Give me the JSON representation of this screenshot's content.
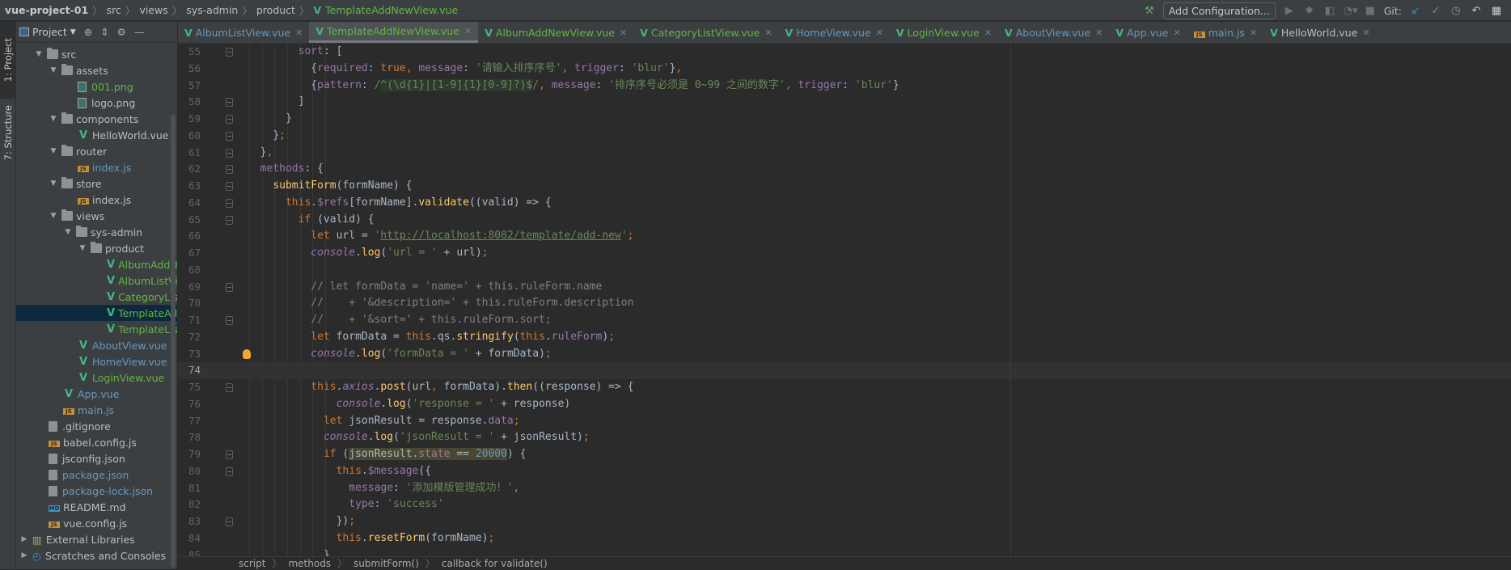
{
  "navbar": {
    "breadcrumb": [
      "vue-project-01",
      "src",
      "views",
      "sys-admin",
      "product"
    ],
    "current_file": "TemplateAddNewView.vue",
    "add_configuration": "Add Configuration...",
    "git_label": "Git:"
  },
  "side_stripe": {
    "project_tab": "1: Project",
    "structure_tab": "7: Structure"
  },
  "project_panel": {
    "title": "Project",
    "tree": [
      {
        "label": "src",
        "depth": 0,
        "kind": "folder",
        "expanded": true,
        "color": "def"
      },
      {
        "label": "assets",
        "depth": 1,
        "kind": "folder",
        "expanded": true,
        "color": "def"
      },
      {
        "label": "001.png",
        "depth": 2,
        "kind": "image",
        "color": "green"
      },
      {
        "label": "logo.png",
        "depth": 2,
        "kind": "image",
        "color": "def"
      },
      {
        "label": "components",
        "depth": 1,
        "kind": "folder",
        "expanded": true,
        "color": "def"
      },
      {
        "label": "HelloWorld.vue",
        "depth": 2,
        "kind": "vue",
        "color": "def"
      },
      {
        "label": "router",
        "depth": 1,
        "kind": "folder",
        "expanded": true,
        "color": "def"
      },
      {
        "label": "index.js",
        "depth": 2,
        "kind": "js",
        "color": "blue"
      },
      {
        "label": "store",
        "depth": 1,
        "kind": "folder",
        "expanded": true,
        "color": "def"
      },
      {
        "label": "index.js",
        "depth": 2,
        "kind": "js",
        "color": "def"
      },
      {
        "label": "views",
        "depth": 1,
        "kind": "folder",
        "expanded": true,
        "color": "def"
      },
      {
        "label": "sys-admin",
        "depth": 2,
        "kind": "folder",
        "expanded": true,
        "color": "def"
      },
      {
        "label": "product",
        "depth": 3,
        "kind": "folder",
        "expanded": true,
        "color": "def"
      },
      {
        "label": "AlbumAddNewView.vue",
        "depth": 4,
        "kind": "vue",
        "color": "green"
      },
      {
        "label": "AlbumListView.vue",
        "depth": 4,
        "kind": "vue",
        "color": "green"
      },
      {
        "label": "CategoryListView.vue",
        "depth": 4,
        "kind": "vue",
        "color": "green"
      },
      {
        "label": "TemplateAddNewView.vue",
        "depth": 4,
        "kind": "vue",
        "color": "green",
        "selected": true
      },
      {
        "label": "TemplateListView.vue",
        "depth": 4,
        "kind": "vue",
        "color": "green"
      },
      {
        "label": "AboutView.vue",
        "depth": 2,
        "kind": "vue",
        "color": "blue"
      },
      {
        "label": "HomeView.vue",
        "depth": 2,
        "kind": "vue",
        "color": "blue"
      },
      {
        "label": "LoginView.vue",
        "depth": 2,
        "kind": "vue",
        "color": "green"
      },
      {
        "label": "App.vue",
        "depth": 1,
        "kind": "vue",
        "color": "blue"
      },
      {
        "label": "main.js",
        "depth": 1,
        "kind": "js",
        "color": "blue"
      },
      {
        "label": ".gitignore",
        "depth": 0,
        "kind": "file",
        "color": "def"
      },
      {
        "label": "babel.config.js",
        "depth": 0,
        "kind": "js",
        "color": "def"
      },
      {
        "label": "jsconfig.json",
        "depth": 0,
        "kind": "file",
        "color": "def"
      },
      {
        "label": "package.json",
        "depth": 0,
        "kind": "file",
        "color": "blue"
      },
      {
        "label": "package-lock.json",
        "depth": 0,
        "kind": "file",
        "color": "blue"
      },
      {
        "label": "README.md",
        "depth": 0,
        "kind": "md",
        "color": "def"
      },
      {
        "label": "vue.config.js",
        "depth": 0,
        "kind": "js",
        "color": "def"
      },
      {
        "label": "External Libraries",
        "depth": -1,
        "kind": "lib",
        "expanded": false,
        "color": "def"
      },
      {
        "label": "Scratches and Consoles",
        "depth": -1,
        "kind": "scratch",
        "expanded": false,
        "color": "def"
      }
    ]
  },
  "tabs": [
    {
      "label": "AlbumListView.vue",
      "kind": "vue",
      "color": "blue"
    },
    {
      "label": "TemplateAddNewView.vue",
      "kind": "vue",
      "color": "green",
      "active": true
    },
    {
      "label": "AlbumAddNewView.vue",
      "kind": "vue",
      "color": "green"
    },
    {
      "label": "CategoryListView.vue",
      "kind": "vue",
      "color": "green"
    },
    {
      "label": "HomeView.vue",
      "kind": "vue",
      "color": "blue"
    },
    {
      "label": "LoginView.vue",
      "kind": "vue",
      "color": "green"
    },
    {
      "label": "AboutView.vue",
      "kind": "vue",
      "color": "blue"
    },
    {
      "label": "App.vue",
      "kind": "vue",
      "color": "blue"
    },
    {
      "label": "main.js",
      "kind": "js",
      "color": "blue"
    },
    {
      "label": "HelloWorld.vue",
      "kind": "vue",
      "color": "def"
    }
  ],
  "editor": {
    "current_line": 74,
    "lines": [
      {
        "n": "55",
        "indent": 8,
        "fold": true,
        "tokens": [
          [
            "f",
            "sort"
          ],
          [
            "p",
            ": ["
          ]
        ]
      },
      {
        "n": "56",
        "indent": 10,
        "tokens": [
          [
            "p",
            "{"
          ],
          [
            "f",
            "required"
          ],
          [
            "p",
            ": "
          ],
          [
            "k",
            "true,"
          ],
          [
            "p",
            " "
          ],
          [
            "f",
            "message"
          ],
          [
            "p",
            ": "
          ],
          [
            "s",
            "'请输入排序序号'"
          ],
          [
            "k",
            ","
          ],
          [
            "p",
            " "
          ],
          [
            "f",
            "trigger"
          ],
          [
            "p",
            ": "
          ],
          [
            "s",
            "'blur'"
          ],
          [
            "p",
            "}"
          ],
          [
            "k",
            ","
          ]
        ]
      },
      {
        "n": "57",
        "indent": 10,
        "tokens": [
          [
            "p",
            "{"
          ],
          [
            "f",
            "pattern"
          ],
          [
            "p",
            ": "
          ],
          [
            "s",
            "/"
          ],
          [
            "r",
            "^(\\d{1}|[1-9]{1}[0-9]?)$"
          ],
          [
            "s",
            "/"
          ],
          [
            "k",
            ","
          ],
          [
            "p",
            " "
          ],
          [
            "f",
            "message"
          ],
          [
            "p",
            ": "
          ],
          [
            "s",
            "'排序序号必须是 0~99 之间的数字'"
          ],
          [
            "k",
            ","
          ],
          [
            "p",
            " "
          ],
          [
            "f",
            "trigger"
          ],
          [
            "p",
            ": "
          ],
          [
            "s",
            "'blur'"
          ],
          [
            "p",
            "}"
          ]
        ]
      },
      {
        "n": "58",
        "indent": 8,
        "fold": true,
        "tokens": [
          [
            "p",
            "]"
          ]
        ]
      },
      {
        "n": "59",
        "indent": 6,
        "fold": true,
        "tokens": [
          [
            "p",
            "}"
          ]
        ]
      },
      {
        "n": "60",
        "indent": 4,
        "fold": true,
        "tokens": [
          [
            "p",
            "}"
          ],
          [
            "k",
            ";"
          ]
        ]
      },
      {
        "n": "61",
        "indent": 2,
        "fold": true,
        "tokens": [
          [
            "p",
            "}"
          ],
          [
            "k",
            ","
          ]
        ]
      },
      {
        "n": "62",
        "indent": 2,
        "fold": true,
        "tokens": [
          [
            "f",
            "methods"
          ],
          [
            "p",
            ": {"
          ]
        ]
      },
      {
        "n": "63",
        "indent": 4,
        "fold": true,
        "tokens": [
          [
            "fn",
            "submitForm"
          ],
          [
            "p",
            "(formName) {"
          ]
        ]
      },
      {
        "n": "64",
        "indent": 6,
        "fold": true,
        "tokens": [
          [
            "k",
            "this"
          ],
          [
            "p",
            "."
          ],
          [
            "f",
            "$refs"
          ],
          [
            "p",
            "[formName]."
          ],
          [
            "fn",
            "validate"
          ],
          [
            "p",
            "((valid) => {"
          ]
        ]
      },
      {
        "n": "65",
        "indent": 8,
        "fold": true,
        "tokens": [
          [
            "k",
            "if"
          ],
          [
            "p",
            " (valid) {"
          ]
        ]
      },
      {
        "n": "66",
        "indent": 10,
        "tokens": [
          [
            "k",
            "let"
          ],
          [
            "p",
            " url = "
          ],
          [
            "s",
            "'"
          ],
          [
            "u",
            "http://localhost:8082/template/add-new"
          ],
          [
            "s",
            "'"
          ],
          [
            "k",
            ";"
          ]
        ]
      },
      {
        "n": "67",
        "indent": 10,
        "tokens": [
          [
            "i",
            "console"
          ],
          [
            "p",
            "."
          ],
          [
            "fn",
            "log"
          ],
          [
            "p",
            "("
          ],
          [
            "s",
            "'url = '"
          ],
          [
            "p",
            " + url)"
          ],
          [
            "k",
            ";"
          ]
        ]
      },
      {
        "n": "68",
        "indent": 10,
        "tokens": []
      },
      {
        "n": "69",
        "indent": 10,
        "fold": true,
        "tokens": [
          [
            "c",
            "// let formData = 'name=' + this.ruleForm.name"
          ]
        ]
      },
      {
        "n": "70",
        "indent": 10,
        "tokens": [
          [
            "c",
            "//    + '&description=' + this.ruleForm.description"
          ]
        ]
      },
      {
        "n": "71",
        "indent": 10,
        "fold": true,
        "tokens": [
          [
            "c",
            "//    + '&sort=' + this.ruleForm.sort;"
          ]
        ]
      },
      {
        "n": "72",
        "indent": 10,
        "tokens": [
          [
            "k",
            "let"
          ],
          [
            "p",
            " formData = "
          ],
          [
            "k",
            "this"
          ],
          [
            "p",
            ".qs."
          ],
          [
            "fn",
            "stringify"
          ],
          [
            "p",
            "("
          ],
          [
            "k",
            "this"
          ],
          [
            "p",
            "."
          ],
          [
            "f",
            "ruleForm"
          ],
          [
            "p",
            ")"
          ],
          [
            "k",
            ";"
          ]
        ]
      },
      {
        "n": "73",
        "indent": 10,
        "bulb": true,
        "tokens": [
          [
            "i",
            "console"
          ],
          [
            "p",
            "."
          ],
          [
            "fn",
            "log"
          ],
          [
            "p",
            "("
          ],
          [
            "s",
            "'formData = '"
          ],
          [
            "p",
            " + formData)"
          ],
          [
            "k",
            ";"
          ]
        ]
      },
      {
        "n": "74",
        "indent": 10,
        "tokens": []
      },
      {
        "n": "75",
        "indent": 10,
        "fold": true,
        "tokens": [
          [
            "k",
            "this"
          ],
          [
            "p",
            "."
          ],
          [
            "i",
            "axios"
          ],
          [
            "p",
            "."
          ],
          [
            "fn",
            "post"
          ],
          [
            "p",
            "(url"
          ],
          [
            "k",
            ","
          ],
          [
            "p",
            " formData)."
          ],
          [
            "fn",
            "then"
          ],
          [
            "p",
            "((response) => {"
          ]
        ]
      },
      {
        "n": "76",
        "indent": 14,
        "tokens": [
          [
            "i",
            "console"
          ],
          [
            "p",
            "."
          ],
          [
            "fn",
            "log"
          ],
          [
            "p",
            "("
          ],
          [
            "s",
            "'response = '"
          ],
          [
            "p",
            " + response)"
          ]
        ]
      },
      {
        "n": "77",
        "indent": 12,
        "tokens": [
          [
            "k",
            "let"
          ],
          [
            "p",
            " jsonResult = response."
          ],
          [
            "f",
            "data"
          ],
          [
            "k",
            ";"
          ]
        ]
      },
      {
        "n": "78",
        "indent": 12,
        "tokens": [
          [
            "i",
            "console"
          ],
          [
            "p",
            "."
          ],
          [
            "fn",
            "log"
          ],
          [
            "p",
            "("
          ],
          [
            "s",
            "'jsonResult = '"
          ],
          [
            "p",
            " + jsonResult)"
          ],
          [
            "k",
            ";"
          ]
        ]
      },
      {
        "n": "79",
        "indent": 12,
        "fold": true,
        "tokens": [
          [
            "k",
            "if"
          ],
          [
            "p",
            " ("
          ],
          [
            "p",
            "jsonResult.",
            "hl"
          ],
          [
            "f",
            "state",
            "hl"
          ],
          [
            "p",
            " == ",
            "hl"
          ],
          [
            "n",
            "20000",
            "hl"
          ],
          [
            "p",
            ") {"
          ]
        ]
      },
      {
        "n": "80",
        "indent": 14,
        "fold": true,
        "tokens": [
          [
            "k",
            "this"
          ],
          [
            "p",
            "."
          ],
          [
            "f",
            "$message"
          ],
          [
            "p",
            "({"
          ]
        ]
      },
      {
        "n": "81",
        "indent": 16,
        "tokens": [
          [
            "f",
            "message"
          ],
          [
            "p",
            ": "
          ],
          [
            "s",
            "'添加模版管理成功！'"
          ],
          [
            "k",
            ","
          ]
        ]
      },
      {
        "n": "82",
        "indent": 16,
        "tokens": [
          [
            "f",
            "type"
          ],
          [
            "p",
            ": "
          ],
          [
            "s",
            "'success'"
          ]
        ]
      },
      {
        "n": "83",
        "indent": 14,
        "fold": true,
        "tokens": [
          [
            "p",
            "})"
          ],
          [
            "k",
            ";"
          ]
        ]
      },
      {
        "n": "84",
        "indent": 14,
        "tokens": [
          [
            "k",
            "this"
          ],
          [
            "p",
            "."
          ],
          [
            "fn",
            "resetForm"
          ],
          [
            "p",
            "(formName)"
          ],
          [
            "k",
            ";"
          ]
        ]
      },
      {
        "n": "85",
        "indent": 12,
        "tokens": [
          [
            "p",
            "}"
          ]
        ]
      }
    ]
  },
  "editor_breadcrumb": [
    "script",
    "methods",
    "submitForm()",
    "callback for validate()"
  ],
  "browser_icons": [
    {
      "name": "chrome",
      "color": "#d6a228"
    },
    {
      "name": "firefox",
      "color": "#e66f2a"
    },
    {
      "name": "safari",
      "color": "#4a8fd8"
    },
    {
      "name": "opera",
      "color": "#d6283a"
    },
    {
      "name": "internet-explorer",
      "color": "#2f8fd8"
    },
    {
      "name": "edge",
      "color": "#2aa5c9"
    }
  ]
}
